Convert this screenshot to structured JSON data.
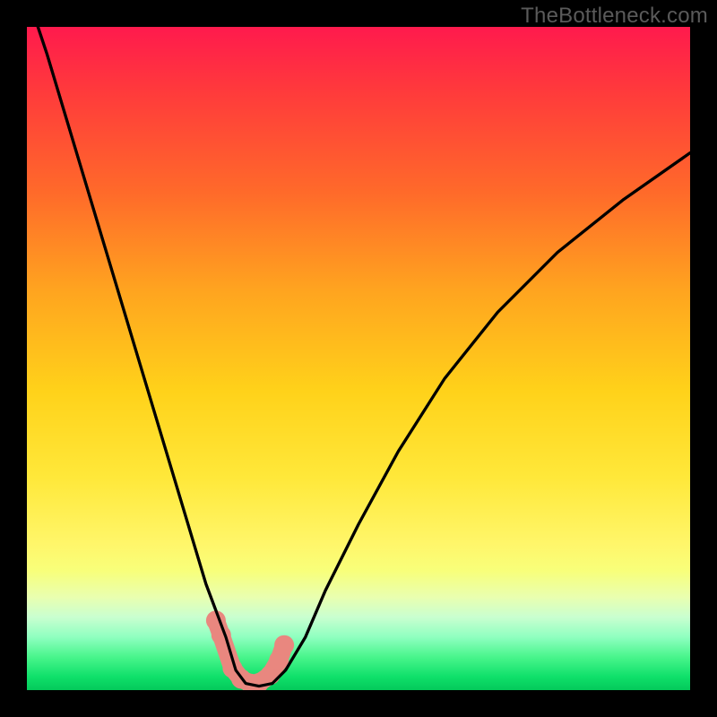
{
  "watermark": "TheBottleneck.com",
  "chart_data": {
    "type": "line",
    "title": "",
    "xlabel": "",
    "ylabel": "",
    "xlim": [
      0,
      100
    ],
    "ylim": [
      0,
      100
    ],
    "series": [
      {
        "name": "bottleneck-curve",
        "x": [
          0,
          3,
          6,
          9,
          12,
          15,
          18,
          21,
          24,
          27,
          30,
          31.5,
          33,
          35,
          37,
          39,
          42,
          45,
          50,
          56,
          63,
          71,
          80,
          90,
          100
        ],
        "values": [
          105,
          96,
          86,
          76,
          66,
          56,
          46,
          36,
          26,
          16,
          8,
          3,
          1,
          0.6,
          1,
          3,
          8,
          15,
          25,
          36,
          47,
          57,
          66,
          74,
          81
        ]
      },
      {
        "name": "highlight-dots",
        "x": [
          28.5,
          29.3,
          31.0,
          32.3,
          33.7,
          35.0,
          36.7,
          38.0,
          38.8
        ],
        "values": [
          10.5,
          8.3,
          3.3,
          1.7,
          1.0,
          1.1,
          2.3,
          4.5,
          6.8
        ]
      }
    ],
    "colors": {
      "curve": "#000000",
      "dots": "#e9877f"
    }
  }
}
